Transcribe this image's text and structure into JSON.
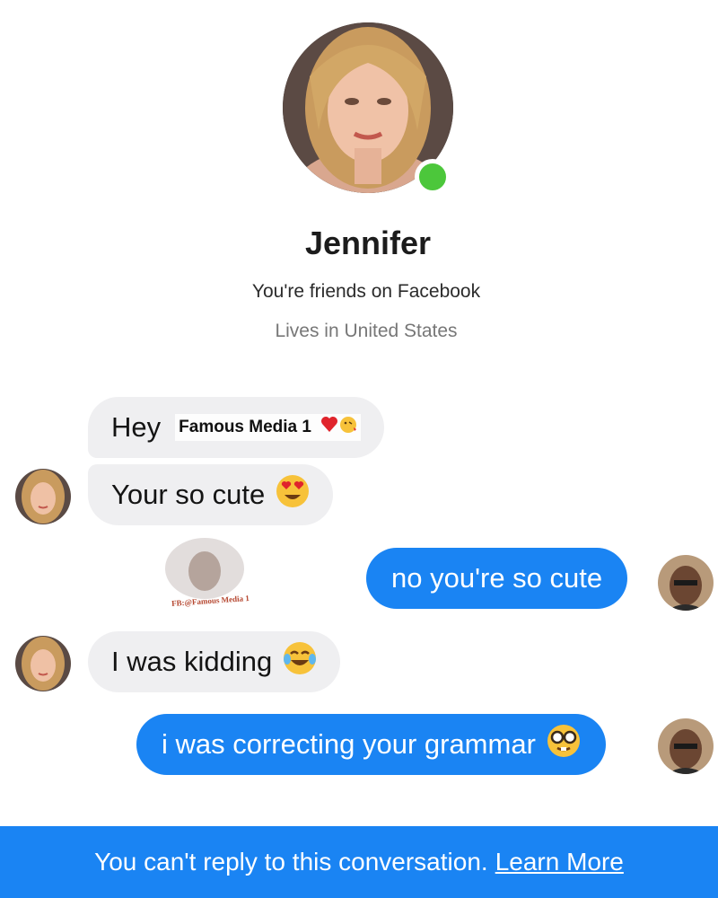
{
  "profile": {
    "name": "Jennifer",
    "relationship": "You're friends on Facebook",
    "location": "Lives in United States",
    "online_color": "#4cc73b"
  },
  "messages": [
    {
      "side": "incoming",
      "text": "Hey",
      "overlay_tag": "Famous Media 1"
    },
    {
      "side": "incoming",
      "text": "Your so cute",
      "emoji": "heart-eyes-emoji"
    },
    {
      "side": "outgoing",
      "text": "no you're so cute"
    },
    {
      "side": "incoming",
      "text": "I was kidding",
      "emoji": "tears-of-joy-emoji"
    },
    {
      "side": "outgoing",
      "text": "i was correcting your grammar",
      "emoji": "nerd-glasses-emoji"
    }
  ],
  "watermark": {
    "text": "FB:@Famous Media 1"
  },
  "footer": {
    "text": "You can't reply to this conversation.",
    "link": "Learn More"
  },
  "colors": {
    "accent": "#1a84f3",
    "incoming_bubble": "#efeff1",
    "background": "#ffffff"
  }
}
